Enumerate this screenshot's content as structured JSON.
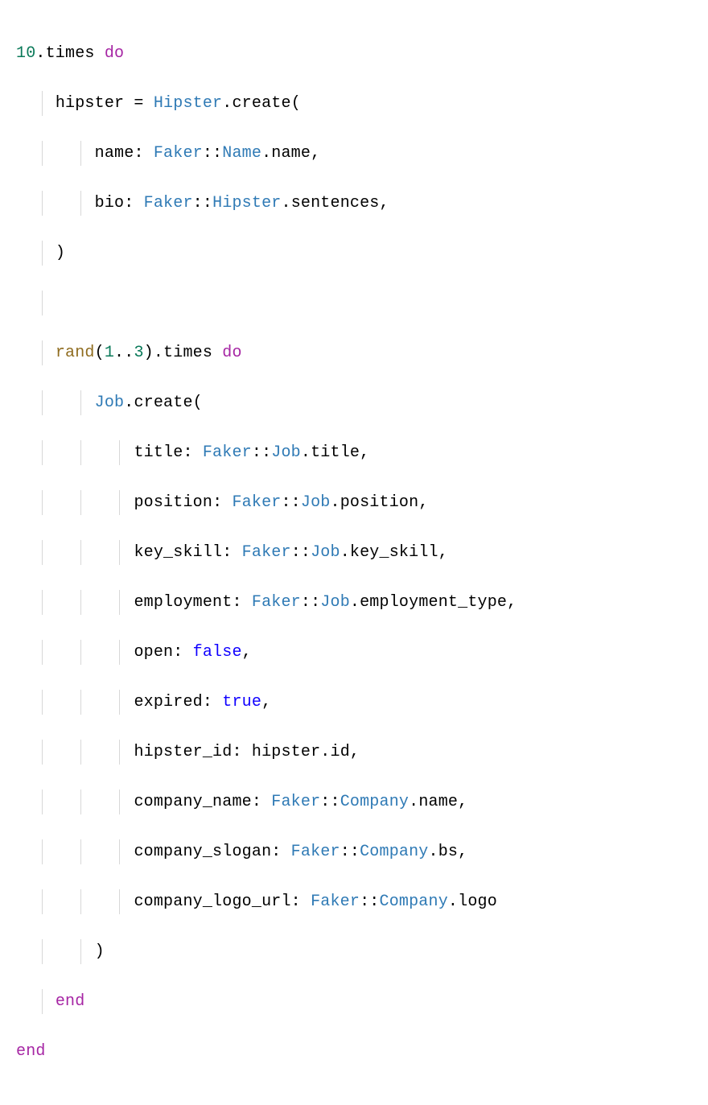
{
  "code": {
    "n10": "10",
    "dot": ".",
    "times": "times",
    "do": "do",
    "end": "end",
    "hipster_var": "hipster",
    "eq": " = ",
    "Hipster": "Hipster",
    "create": "create",
    "lp": "(",
    "rp": ")",
    "comma": ",",
    "colon": ":",
    "scope": "::",
    "name_key": "name",
    "Faker": "Faker",
    "Name": "Name",
    "name_m": "name",
    "bio_key": "bio",
    "HipsterC": "Hipster",
    "sentences": "sentences",
    "rand": "rand",
    "n1": "1",
    "range": "..",
    "n3": "3",
    "Job": "Job",
    "title_k": "title",
    "JobC": "Job",
    "title_m": "title",
    "position_k": "position",
    "position_m": "position",
    "keyskill_k": "key_skill",
    "keyskill_m": "key_skill",
    "employment_k": "employment",
    "employment_m": "employment_type",
    "open_k": "open",
    "false": "false",
    "expired_k": "expired",
    "true": "true",
    "hipster_id_k": "hipster_id",
    "hipster_v": "hipster",
    "id_m": "id",
    "company_name_k": "company_name",
    "Company": "Company",
    "company_slogan_k": "company_slogan",
    "bs_m": "bs",
    "company_logo_k": "company_logo_url",
    "logo_m": "logo"
  }
}
